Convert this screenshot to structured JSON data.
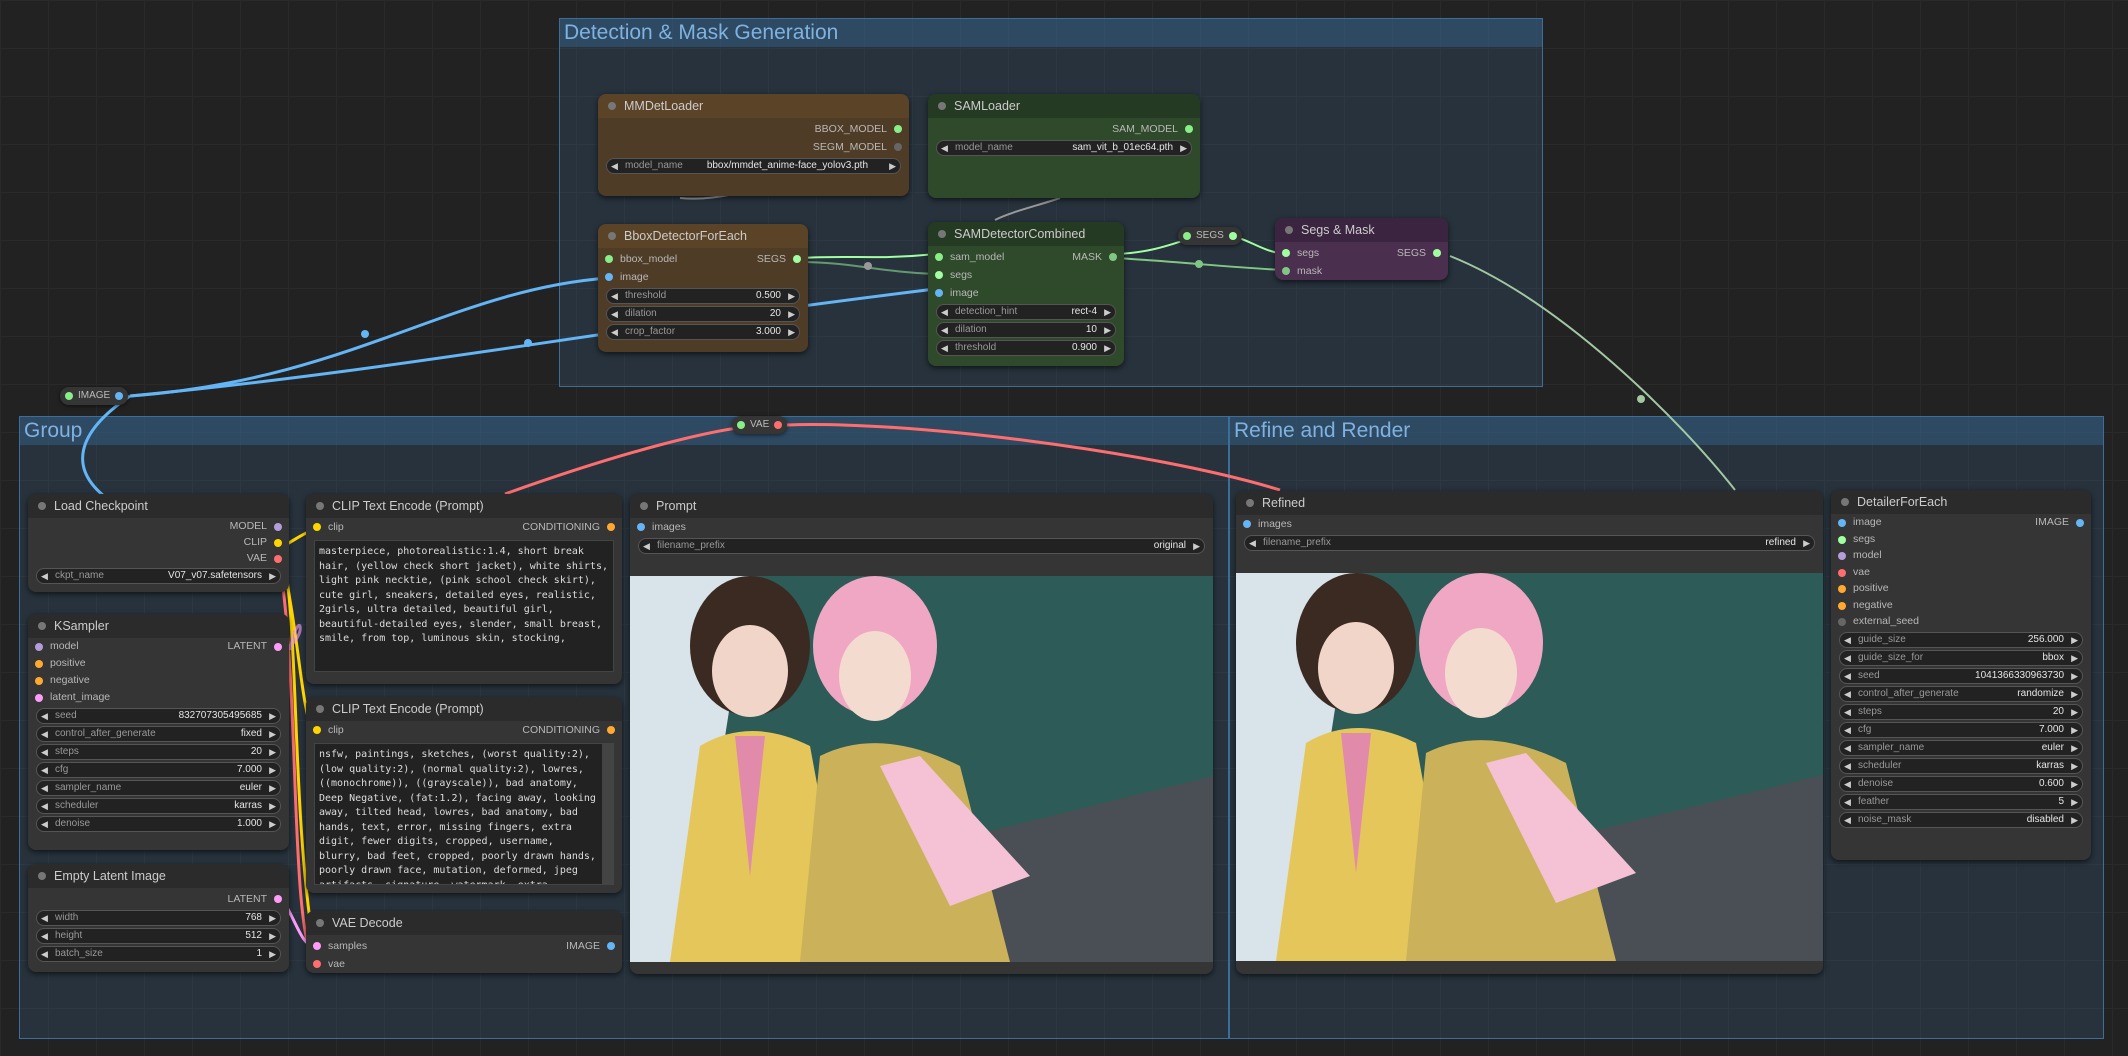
{
  "groups": {
    "detection": "Detection & Mask Generation",
    "group": "Group",
    "refine": "Refine and Render"
  },
  "nodes": {
    "mmdet": {
      "title": "MMDetLoader",
      "out1": "BBOX_MODEL",
      "out2": "SEGM_MODEL",
      "w_label": "model_name",
      "w_value": "bbox/mmdet_anime-face_yolov3.pth"
    },
    "samloader": {
      "title": "SAMLoader",
      "out1": "SAM_MODEL",
      "w_label": "model_name",
      "w_value": "sam_vit_b_01ec64.pth"
    },
    "bbox": {
      "title": "BboxDetectorForEach",
      "in1": "bbox_model",
      "in2": "image",
      "out1": "SEGS",
      "widgets": [
        {
          "label": "threshold",
          "value": "0.500"
        },
        {
          "label": "dilation",
          "value": "20"
        },
        {
          "label": "crop_factor",
          "value": "3.000"
        }
      ]
    },
    "samdet": {
      "title": "SAMDetectorCombined",
      "in1": "sam_model",
      "in2": "segs",
      "in3": "image",
      "out1": "MASK",
      "widgets": [
        {
          "label": "detection_hint",
          "value": "rect-4"
        },
        {
          "label": "dilation",
          "value": "10"
        },
        {
          "label": "threshold",
          "value": "0.900"
        }
      ]
    },
    "segsmask": {
      "title": "Segs & Mask",
      "in1": "segs",
      "in2": "mask",
      "out1": "SEGS"
    },
    "checkpoint": {
      "title": "Load Checkpoint",
      "out1": "MODEL",
      "out2": "CLIP",
      "out3": "VAE",
      "w_label": "ckpt_name",
      "w_value": "V07_v07.safetensors"
    },
    "ksampler": {
      "title": "KSampler",
      "in1": "model",
      "in2": "positive",
      "in3": "negative",
      "in4": "latent_image",
      "out1": "LATENT",
      "widgets": [
        {
          "label": "seed",
          "value": "832707305495685"
        },
        {
          "label": "control_after_generate",
          "value": "fixed"
        },
        {
          "label": "steps",
          "value": "20"
        },
        {
          "label": "cfg",
          "value": "7.000"
        },
        {
          "label": "sampler_name",
          "value": "euler"
        },
        {
          "label": "scheduler",
          "value": "karras"
        },
        {
          "label": "denoise",
          "value": "1.000"
        }
      ]
    },
    "latent": {
      "title": "Empty Latent Image",
      "out1": "LATENT",
      "widgets": [
        {
          "label": "width",
          "value": "768"
        },
        {
          "label": "height",
          "value": "512"
        },
        {
          "label": "batch_size",
          "value": "1"
        }
      ]
    },
    "clip1": {
      "title": "CLIP Text Encode (Prompt)",
      "in1": "clip",
      "out1": "CONDITIONING",
      "text": "masterpiece, photorealistic:1.4, short break hair, (yellow check short jacket), white shirts, light pink necktie, (pink school check skirt), cute girl, sneakers, detailed eyes, realistic, 2girls, ultra detailed, beautiful girl, beautiful-detailed eyes, slender, small breast, smile, from top, luminous skin, stocking,"
    },
    "clip2": {
      "title": "CLIP Text Encode (Prompt)",
      "in1": "clip",
      "out1": "CONDITIONING",
      "text": "nsfw, paintings, sketches, (worst quality:2), (low quality:2), (normal quality:2), lowres, ((monochrome)), ((grayscale)), bad anatomy, Deep Negative, (fat:1.2), facing away, looking away, tilted head, lowres, bad anatomy, bad hands, text, error, missing fingers, extra digit, fewer digits, cropped, username, blurry, bad feet, cropped, poorly drawn hands, poorly drawn face, mutation, deformed, jpeg artifacts, signature, watermark, extra fingers, fewer digits, extra limbs,"
    },
    "vaedecode": {
      "title": "VAE Decode",
      "in1": "samples",
      "in2": "vae",
      "out1": "IMAGE"
    },
    "prompt": {
      "title": "Prompt",
      "in1": "images",
      "w_label": "filename_prefix",
      "w_value": "original"
    },
    "refined": {
      "title": "Refined",
      "in1": "images",
      "w_label": "filename_prefix",
      "w_value": "refined"
    },
    "detailer": {
      "title": "DetailerForEach",
      "in1": "image",
      "in2": "segs",
      "in3": "model",
      "in4": "vae",
      "in5": "positive",
      "in6": "negative",
      "in7": "external_seed",
      "out1": "IMAGE",
      "widgets": [
        {
          "label": "guide_size",
          "value": "256.000"
        },
        {
          "label": "guide_size_for",
          "value": "bbox"
        },
        {
          "label": "seed",
          "value": "1041366330963730"
        },
        {
          "label": "control_after_generate",
          "value": "randomize"
        },
        {
          "label": "steps",
          "value": "20"
        },
        {
          "label": "cfg",
          "value": "7.000"
        },
        {
          "label": "sampler_name",
          "value": "euler"
        },
        {
          "label": "scheduler",
          "value": "karras"
        },
        {
          "label": "denoise",
          "value": "0.600"
        },
        {
          "label": "feather",
          "value": "5"
        },
        {
          "label": "noise_mask",
          "value": "disabled"
        }
      ]
    }
  },
  "reroutes": {
    "image": "IMAGE",
    "vae": "VAE",
    "segs": "SEGS"
  },
  "colors": {
    "image": "#64b5f6",
    "clip": "#ffd500",
    "model": "#b39ddb",
    "vae": "#ff6e6e",
    "conditioning": "#ffa931",
    "latent": "#ff9cf9",
    "segs": "#a1ffa1",
    "mask": "#81c784"
  }
}
